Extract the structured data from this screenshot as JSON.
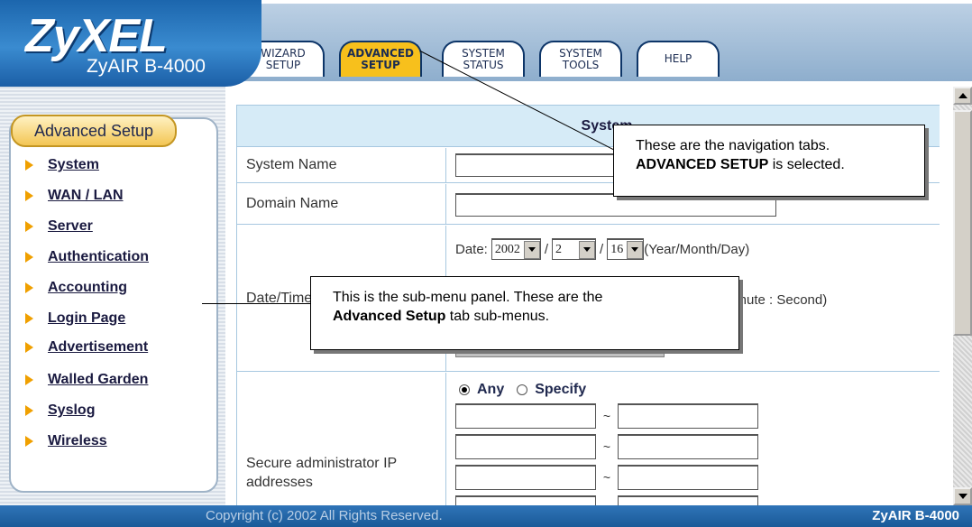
{
  "header": {
    "logo_main": "ZyXEL",
    "logo_sub": "ZyAIR B-4000",
    "tabs": [
      {
        "line1": "WIZARD",
        "line2": "SETUP"
      },
      {
        "line1": "ADVANCED",
        "line2": "SETUP"
      },
      {
        "line1": "SYSTEM",
        "line2": "STATUS"
      },
      {
        "line1": "SYSTEM",
        "line2": "TOOLS"
      },
      {
        "line1": "HELP",
        "line2": ""
      }
    ],
    "active_tab": "ADVANCED SETUP"
  },
  "sidebar": {
    "title": "Advanced Setup",
    "items": [
      {
        "label": "System"
      },
      {
        "label": "WAN / LAN"
      },
      {
        "label": "Server"
      },
      {
        "label": "Authentication"
      },
      {
        "label": "Accounting"
      },
      {
        "label": "Login Page"
      },
      {
        "label": "Advertisement"
      },
      {
        "label": "Walled Garden"
      },
      {
        "label": "Syslog"
      },
      {
        "label": "Wireless"
      }
    ]
  },
  "main": {
    "section_title": "System",
    "system_name": {
      "label": "System Name",
      "value": ""
    },
    "domain_name": {
      "label": "Domain Name",
      "value": ""
    },
    "date_time": {
      "label": "Date/Time",
      "date_prefix": "Date:",
      "year": "2002",
      "month": "2",
      "day": "16",
      "separator": "/",
      "date_format": "(Year/Month/Day)",
      "time_format_visible": "linute : Second)"
    },
    "secure_ip": {
      "label": "Secure administrator IP addresses",
      "option_any": "Any",
      "option_specify": "Specify",
      "selected": "Any",
      "range_separator": "~"
    }
  },
  "callouts": {
    "tabs_note_line1": "These are the navigation tabs.",
    "tabs_note_bold": "ADVANCED SETUP",
    "tabs_note_rest": " is selected.",
    "submenu_note_line1": "This is the sub-menu panel. These are the",
    "submenu_note_bold": "Advanced Setup",
    "submenu_note_rest": " tab sub-menus."
  },
  "footer": {
    "copyright": "Copyright (c) 2002 All Rights Reserved.",
    "brand": "ZyAIR B-4000"
  },
  "colors": {
    "brand_blue": "#1c66ad",
    "active_tab": "#f7c01c",
    "menu_arrow": "#f0a000",
    "table_header": "#d6ebf7"
  }
}
